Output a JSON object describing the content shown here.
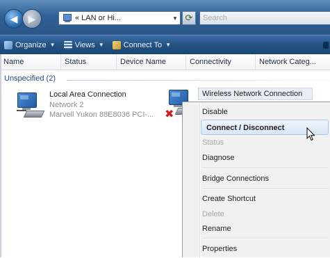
{
  "address": {
    "path_text": "« LAN or Hi...",
    "search_placeholder": "Search"
  },
  "toolbar": {
    "items": [
      {
        "label": "Organize",
        "icon": "organize-icon"
      },
      {
        "label": "Views",
        "icon": "views-icon"
      },
      {
        "label": "Connect To",
        "icon": "connect-to-icon"
      }
    ]
  },
  "columns": [
    "Name",
    "Status",
    "Device Name",
    "Connectivity",
    "Network Categ..."
  ],
  "group": {
    "label": "Unspecified (2)"
  },
  "connections": [
    {
      "name": "Local Area Connection",
      "status": "Network 2",
      "device": "Marvell Yukon 88E8036 PCI-..."
    },
    {
      "name": "Wireless Network Connection",
      "icon": "wireless-adapter-icon",
      "status_icon": "disconnected-x-icon"
    }
  ],
  "context_menu": {
    "items": [
      {
        "label": "Disable",
        "state": "normal"
      },
      {
        "label": "Connect / Disconnect",
        "state": "highlighted"
      },
      {
        "label": "Status",
        "state": "disabled"
      },
      {
        "label": "Diagnose",
        "state": "normal"
      },
      {
        "label": "Bridge Connections",
        "state": "normal"
      },
      {
        "label": "Create Shortcut",
        "state": "normal"
      },
      {
        "label": "Delete",
        "state": "disabled"
      },
      {
        "label": "Rename",
        "state": "normal"
      },
      {
        "label": "Properties",
        "state": "normal"
      }
    ]
  },
  "colors": {
    "accent": "#2f6096",
    "highlight": "#d9e7f7",
    "error": "#d41b1b"
  }
}
